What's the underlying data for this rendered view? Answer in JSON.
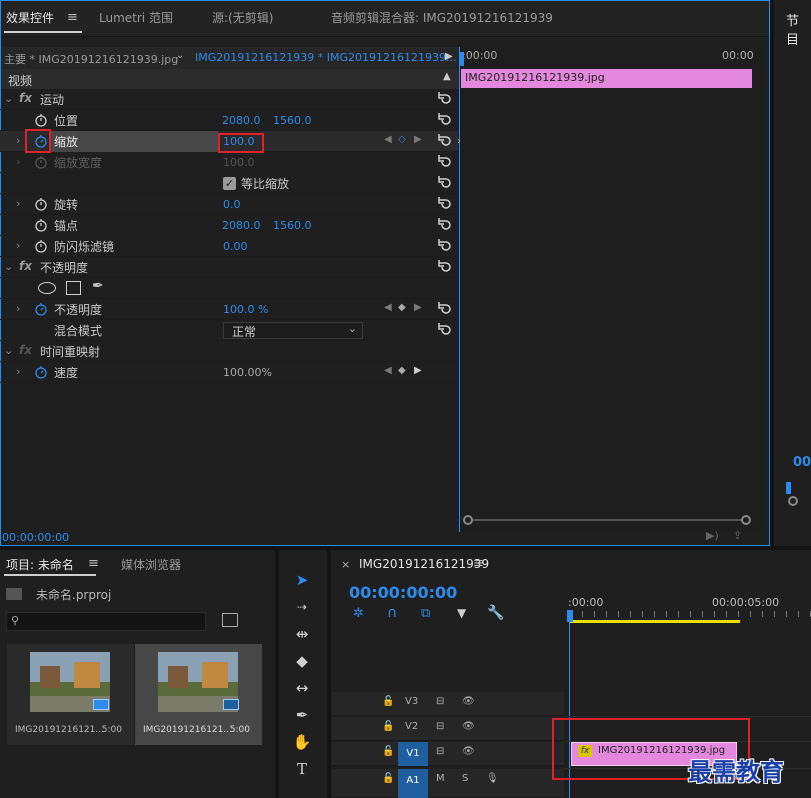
{
  "effect_controls": {
    "tabs": [
      "效果控件",
      "Lumetri 范围",
      "源:(无剪辑)",
      "音频剪辑混合器: IMG20191216121939"
    ],
    "master_label": "主要 * IMG20191216121939.jpg",
    "sequence_label": "IMG20191216121939 * IMG20191216121939...",
    "section_video": "视频",
    "motion": {
      "title": "运动",
      "position_label": "位置",
      "position_x": "2080.0",
      "position_y": "1560.0",
      "scale_label": "缩放",
      "scale_value": "100.0",
      "scale_width_label": "缩放宽度",
      "scale_width_value": "100.0",
      "uniform_label": "等比缩放",
      "rotation_label": "旋转",
      "rotation_value": "0.0",
      "anchor_label": "锚点",
      "anchor_x": "2080.0",
      "anchor_y": "1560.0",
      "flicker_label": "防闪烁滤镜",
      "flicker_value": "0.00"
    },
    "opacity": {
      "title": "不透明度",
      "opacity_label": "不透明度",
      "opacity_value": "100.0 %",
      "blend_label": "混合模式",
      "blend_value": "正常"
    },
    "time_remap": {
      "title": "时间重映射",
      "speed_label": "速度",
      "speed_value": "100.00%"
    },
    "timecode": "00:00:00:00",
    "ruler_start": ":00:00",
    "ruler_end": "00:00",
    "clip_name": "IMG20191216121939.jpg"
  },
  "program": {
    "tab": "节目",
    "timecode_partial": "00"
  },
  "project": {
    "tabs": [
      "项目: 未命名",
      "媒体浏览器"
    ],
    "project_file": "未命名.prproj",
    "items": [
      {
        "name": "IMG20191216121...",
        "duration": "5:00"
      },
      {
        "name": "IMG20191216121...",
        "duration": "5:00"
      }
    ]
  },
  "timeline": {
    "tab": "IMG20191216121939",
    "timecode": "00:00:00:00",
    "ruler_start": ":00:00",
    "ruler_mid": "00:00:05:00",
    "tracks": [
      "V3",
      "V2",
      "V1",
      "A1"
    ],
    "a1_m": "M",
    "a1_s": "S",
    "clip_name": "IMG20191216121939.jpg",
    "clip_fx": "fx"
  },
  "watermark": "最需教育",
  "colors": {
    "accent": "#2d8ceb",
    "clip": "#e488de",
    "highlight": "#e0202a",
    "workarea": "#e8e000"
  }
}
